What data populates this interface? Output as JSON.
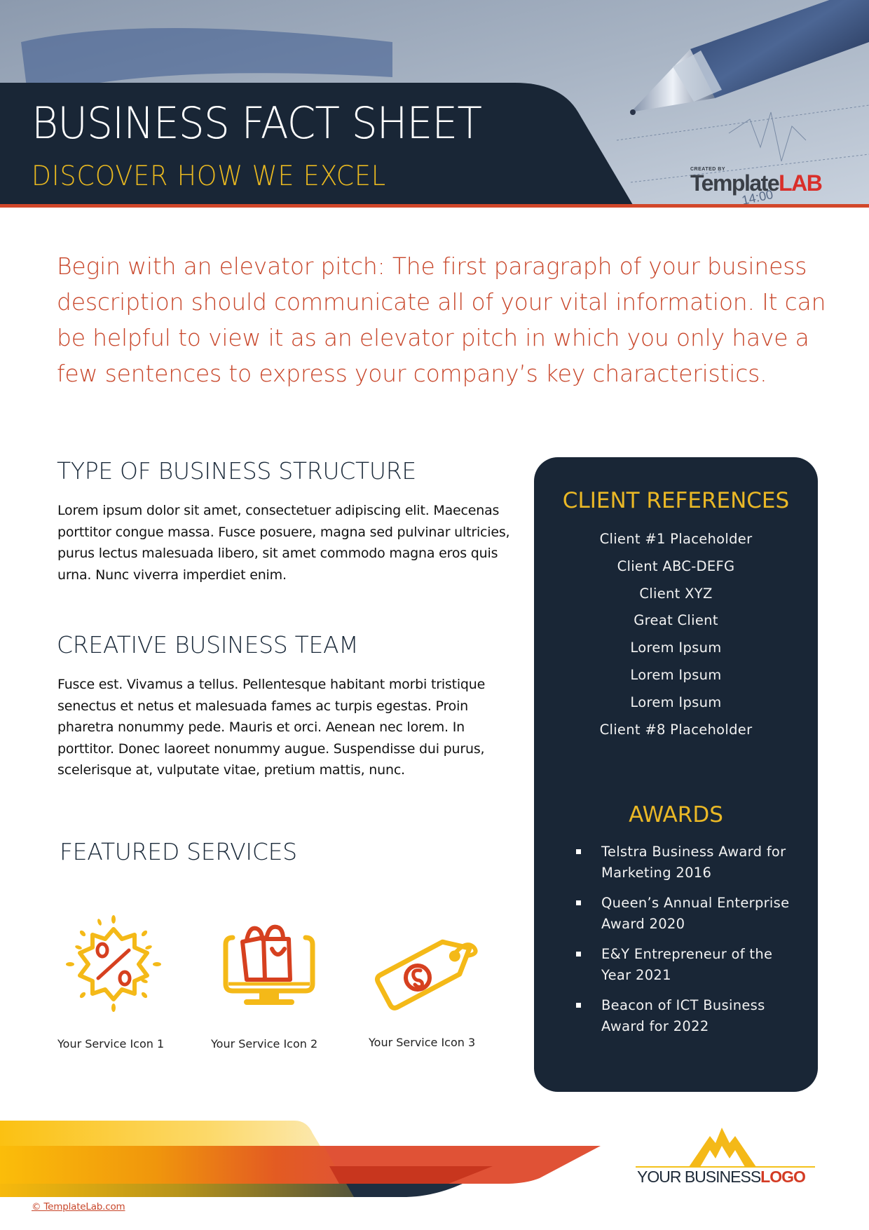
{
  "header": {
    "title": "BUSINESS FACT SHEET",
    "subtitle": "DISCOVER HOW WE EXCEL",
    "brand": {
      "created_by": "CREATED BY",
      "name_part1": "Template",
      "name_part2": "LAB"
    },
    "photo_clock_text": "14:00"
  },
  "lead_paragraph": "Begin with an elevator pitch: The first paragraph of your business description should communicate all of your vital information. It can be helpful to view it as an elevator pitch in which you only have a few sentences to express your company’s key characteristics.",
  "sections": {
    "structure": {
      "heading": "TYPE OF BUSINESS STRUCTURE",
      "body": "Lorem ipsum dolor sit amet, consectetuer adipiscing elit. Maecenas porttitor congue massa. Fusce posuere, magna sed pulvinar ultricies, purus lectus malesuada libero, sit amet commodo magna eros quis urna. Nunc viverra imperdiet enim."
    },
    "team": {
      "heading": "CREATIVE BUSINESS TEAM",
      "body": "Fusce est. Vivamus a tellus. Pellentesque habitant morbi tristique senectus et netus et malesuada fames ac turpis egestas. Proin pharetra nonummy pede. Mauris et orci. Aenean nec lorem. In porttitor. Donec laoreet nonummy augue. Suspendisse dui purus, scelerisque at, vulputate vitae, pretium mattis, nunc."
    },
    "services": {
      "heading": "FEATURED SERVICES",
      "items": [
        {
          "label": "Your Service Icon 1",
          "icon": "discount-badge-icon"
        },
        {
          "label": "Your Service Icon 2",
          "icon": "online-shopping-monitor-icon"
        },
        {
          "label": "Your Service Icon 3",
          "icon": "price-tag-icon"
        }
      ]
    }
  },
  "panel": {
    "clients_heading": "CLIENT REFERENCES",
    "clients": [
      "Client #1 Placeholder",
      "Client ABC-DEFG",
      "Client XYZ",
      "Great Client",
      "Lorem Ipsum",
      "Lorem Ipsum",
      "Lorem Ipsum",
      "Client #8 Placeholder"
    ],
    "awards_heading": "AWARDS",
    "awards": [
      "Telstra Business Award for Marketing 2016",
      "Queen’s Annual Enterprise Award 2020",
      "E&Y Entrepreneur of the Year 2021",
      "Beacon of ICT Business Award for 2022"
    ]
  },
  "footer": {
    "logo_text_part1": "YOUR BUSINESS",
    "logo_text_part2": "LOGO",
    "copyright": "© TemplateLab.com"
  },
  "colors": {
    "navy": "#192636",
    "accent_red": "#c8462a",
    "accent_yellow": "#eab826",
    "white": "#ffffff"
  }
}
